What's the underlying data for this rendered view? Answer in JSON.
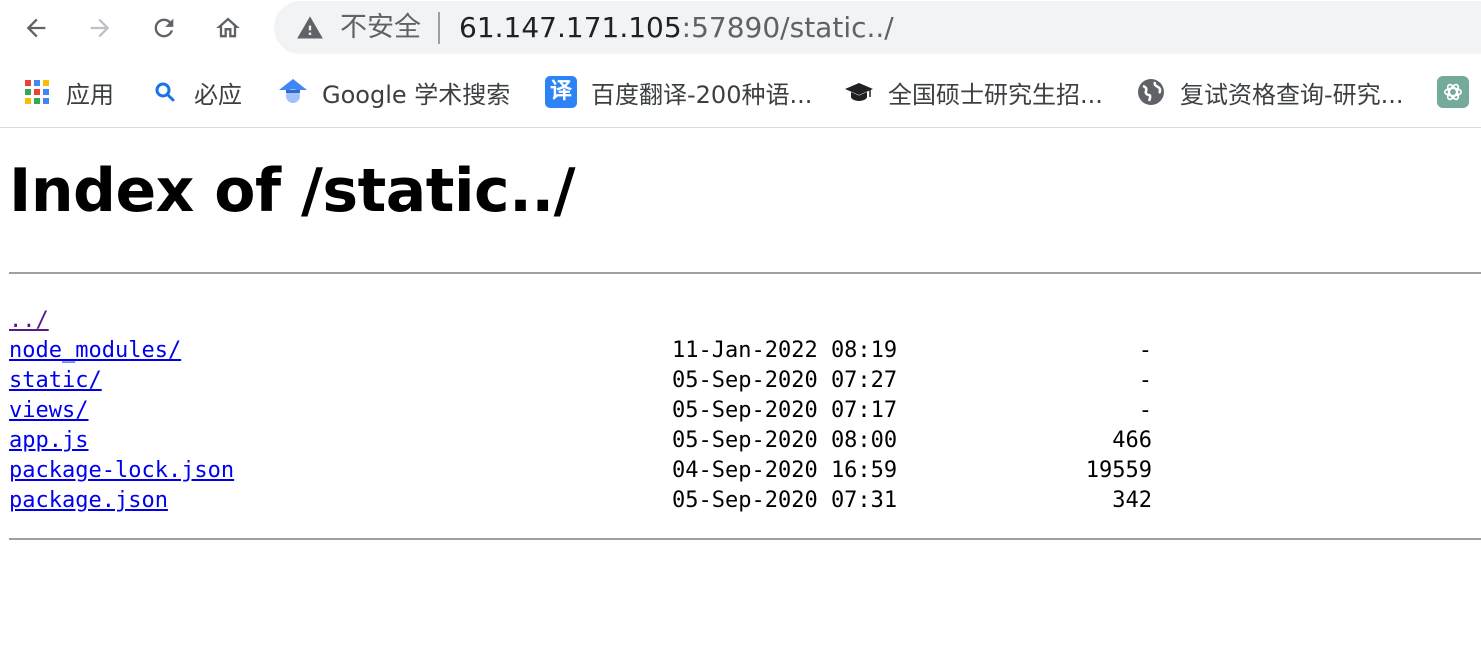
{
  "browser": {
    "security_label": "不安全",
    "url_host": "61.147.171.105",
    "url_rest": ":57890/static../"
  },
  "bookmarks": [
    {
      "label": "应用",
      "icon": "apps-grid-icon"
    },
    {
      "label": "必应",
      "icon": "search-icon"
    },
    {
      "label": "Google 学术搜索",
      "icon": "scholar-cap-icon"
    },
    {
      "label": "百度翻译-200种语...",
      "icon": "translate-icon",
      "icon_text": "译"
    },
    {
      "label": "全国硕士研究生招...",
      "icon": "graduation-cap-icon"
    },
    {
      "label": "复试资格查询-研究...",
      "icon": "globe-icon"
    },
    {
      "label": "",
      "icon": "openai-icon"
    }
  ],
  "page": {
    "title": "Index of /static../",
    "entries": [
      {
        "name": "../",
        "date": "",
        "size": "",
        "visited": true
      },
      {
        "name": "node_modules/",
        "date": "11-Jan-2022 08:19",
        "size": "-"
      },
      {
        "name": "static/",
        "date": "05-Sep-2020 07:27",
        "size": "-"
      },
      {
        "name": "views/",
        "date": "05-Sep-2020 07:17",
        "size": "-"
      },
      {
        "name": "app.js",
        "date": "05-Sep-2020 08:00",
        "size": "466"
      },
      {
        "name": "package-lock.json",
        "date": "04-Sep-2020 16:59",
        "size": "19559"
      },
      {
        "name": "package.json",
        "date": "05-Sep-2020 07:31",
        "size": "342"
      }
    ]
  },
  "colors": {
    "link": "#0000ee",
    "link_visited": "#551a8b",
    "omnibox_bg": "#f1f3f4",
    "rule": "#a0a0a0"
  }
}
